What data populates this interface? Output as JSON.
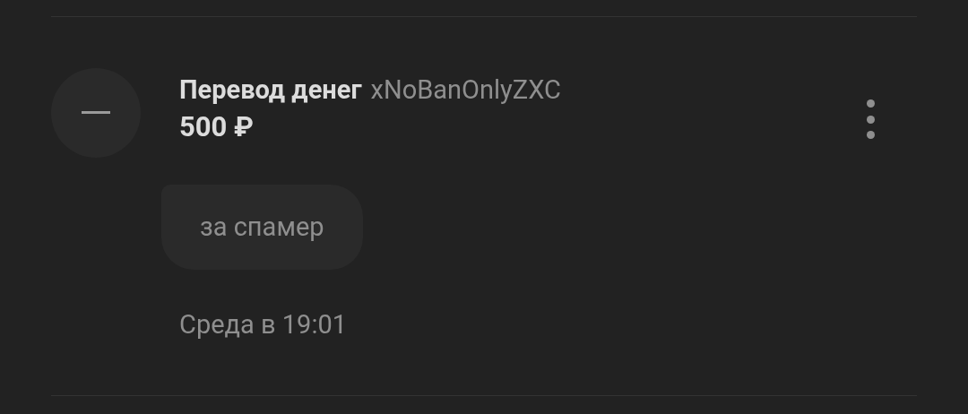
{
  "transaction": {
    "action": "Перевод денег",
    "recipient": "xNoBanOnlyZXC",
    "amount": "500 ₽",
    "comment": "за спамер",
    "date": "Среда в 19:01"
  }
}
